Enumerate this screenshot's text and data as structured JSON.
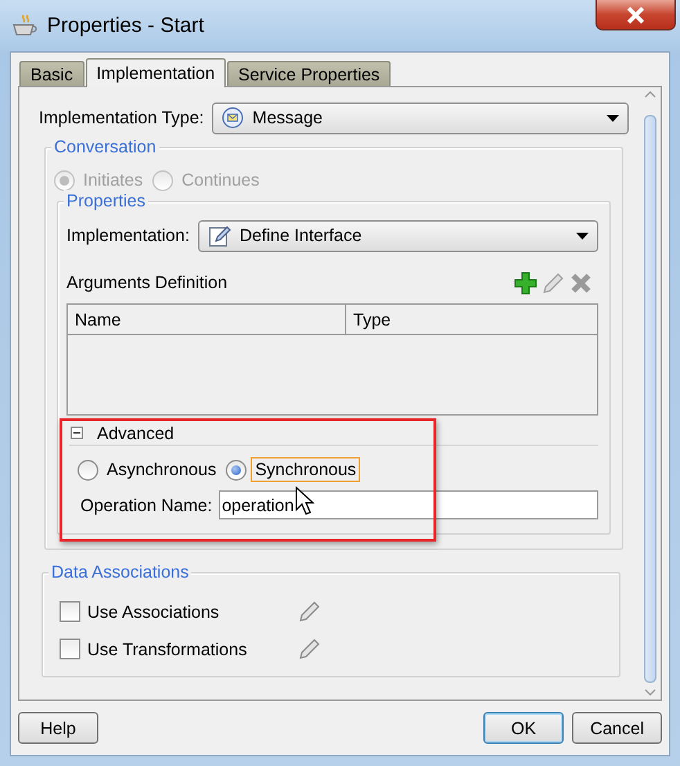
{
  "window": {
    "title": "Properties - Start"
  },
  "tabs": [
    {
      "label": "Basic",
      "selected": false
    },
    {
      "label": "Implementation",
      "selected": true
    },
    {
      "label": "Service Properties",
      "selected": false
    }
  ],
  "implementation_type": {
    "label": "Implementation Type:",
    "value": "Message"
  },
  "conversation": {
    "title": "Conversation",
    "disabled": true,
    "options": [
      {
        "label": "Initiates",
        "selected": true
      },
      {
        "label": "Continues",
        "selected": false
      }
    ]
  },
  "properties": {
    "title": "Properties",
    "implementation": {
      "label": "Implementation:",
      "value": "Define Interface"
    },
    "arguments": {
      "title": "Arguments Definition",
      "columns": [
        "Name",
        "Type"
      ]
    },
    "advanced": {
      "title": "Advanced",
      "expanded": true,
      "modes": [
        {
          "label": "Asynchronous",
          "selected": false,
          "focused": false
        },
        {
          "label": "Synchronous",
          "selected": true,
          "focused": true
        }
      ],
      "operation_name": {
        "label": "Operation Name:",
        "value": "operation"
      }
    }
  },
  "data_associations": {
    "title": "Data Associations",
    "options": [
      {
        "label": "Use Associations",
        "checked": false
      },
      {
        "label": "Use Transformations",
        "checked": false
      }
    ]
  },
  "buttons": [
    {
      "label": "Help",
      "default": false
    },
    {
      "label": "OK",
      "default": true
    },
    {
      "label": "Cancel",
      "default": false
    }
  ]
}
